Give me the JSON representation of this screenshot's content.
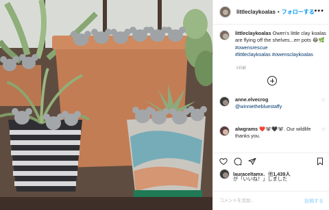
{
  "post": {
    "username": "littleclaykoalas",
    "separator": "•",
    "follow_label": "フォローする",
    "more_icon": "more-options-icon",
    "caption": {
      "username": "littleclaykoalas",
      "text": " Owen's little clay koalas are flying off the shelves...err pots 😂🌿 ",
      "hashtag_1": "#owensrescue",
      "hashtag_2": "#littleclaykoalas",
      "hashtag_3": "#owensclaykoalas"
    },
    "time_ago": "5日前",
    "load_more_icon": "add-circle-icon"
  },
  "comments": [
    {
      "username": "anne.elvecrog",
      "text": "@winniethebluestaffy"
    },
    {
      "username": "alwgrams",
      "emoji_1": "❤️",
      "emoji_2": "🐨",
      "emoji_3": "🖤",
      "emoji_4": "🐨",
      "text": ". Our wildlife thanks you."
    }
  ],
  "actions": {
    "like_icon": "heart-icon",
    "comment_icon": "comment-icon",
    "share_icon": "paper-plane-icon",
    "save_icon": "bookmark-icon"
  },
  "likes": {
    "user": "lauraceltamx",
    "connector": "、他",
    "count": "1,439人",
    "suffix": "が「いいね！」しました"
  },
  "comment_input": {
    "placeholder": "コメントを追加...",
    "post_label": "投稿する"
  },
  "colors": {
    "link": "#0095f6",
    "hashtag": "#00376b",
    "secondary_text": "#8e8e8e",
    "heart": "#ed4956"
  }
}
